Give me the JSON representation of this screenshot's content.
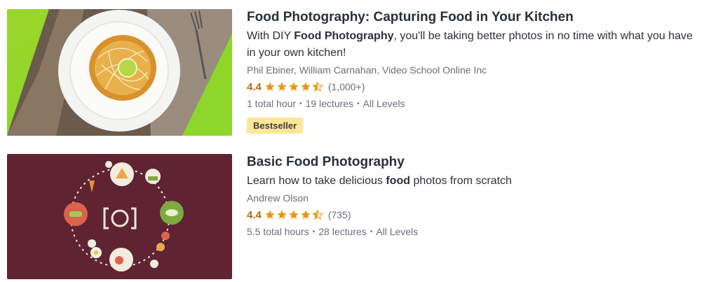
{
  "courses": [
    {
      "title": "Food Photography: Capturing Food in Your Kitchen",
      "description_pre": "With DIY ",
      "description_bold": "Food Photography",
      "description_post": ", you'll be taking better photos in no time with what you have in your own kitchen!",
      "instructors": "Phil Ebiner, William Carnahan, Video School Online Inc",
      "rating": "4.4",
      "stars": 4.4,
      "rating_count": "(1,000+)",
      "hours": "1 total hour",
      "lectures": "19 lectures",
      "level": "All Levels",
      "badge": "Bestseller"
    },
    {
      "title": "Basic Food Photography",
      "description_pre": "Learn how to take delicious ",
      "description_bold": "food",
      "description_post": " photos from scratch",
      "instructors": "Andrew Olson",
      "rating": "4.4",
      "stars": 4.4,
      "rating_count": "(735)",
      "hours": "5.5 total hours",
      "lectures": "28 lectures",
      "level": "All Levels"
    }
  ],
  "icons": {
    "star": "star-icon",
    "half_star": "star-half-icon",
    "camera": "camera-icon"
  },
  "colors": {
    "rating": "#b4690e",
    "star": "#e59819",
    "badge_bg": "#ffe799",
    "thumb2_bg": "#5f2332",
    "thumb1_green": "#8fd62b"
  },
  "separator": "•"
}
